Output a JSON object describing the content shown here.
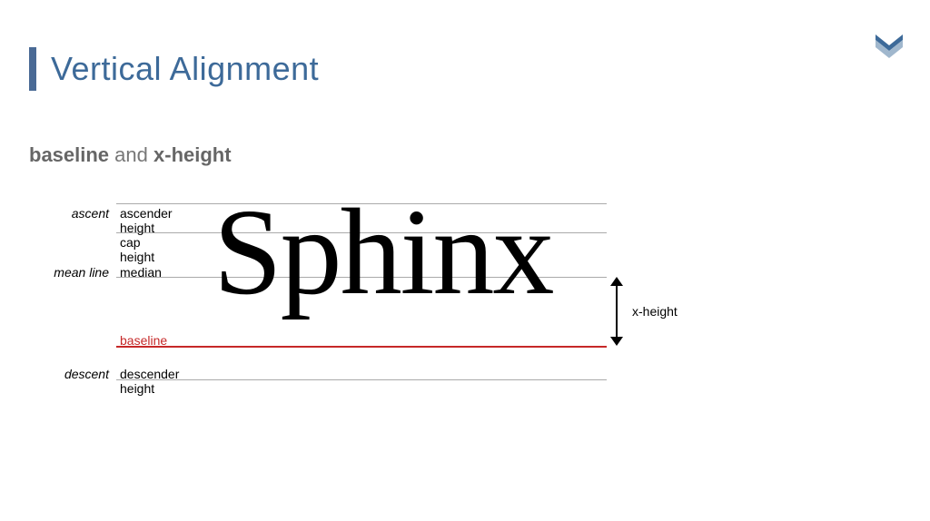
{
  "title": "Vertical Alignment",
  "subtitle": {
    "part1": "baseline",
    "part2": "and",
    "part3": "x-height"
  },
  "diagram": {
    "word": "Sphinx",
    "leftLabels": {
      "ascent": "ascent",
      "meanLine": "mean line",
      "descent": "descent"
    },
    "midLabels": {
      "ascenderHeight": "ascender height",
      "capHeight": "cap height",
      "median": "median",
      "baseline": "baseline",
      "descenderHeight": "descender height"
    },
    "rightLabel": "x-height"
  }
}
